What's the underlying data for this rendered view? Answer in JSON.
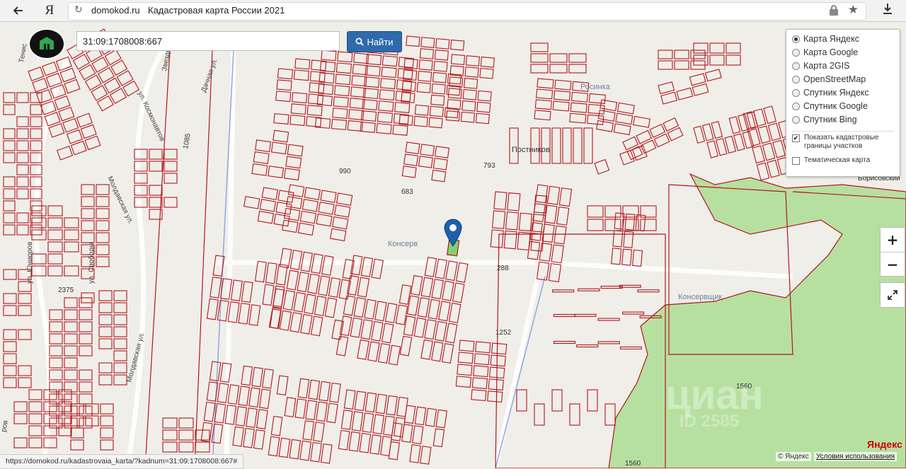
{
  "browser": {
    "domain": "domokod.ru",
    "page_title": "Кадастровая карта России 2021",
    "yandex_button": "Я",
    "back_icon": "arrow-left-icon",
    "reload_icon": "reload-icon",
    "lock_icon": "lock-icon",
    "star_icon": "star-icon",
    "download_icon": "download-icon"
  },
  "search": {
    "value": "31:09:1708008:667",
    "button_label": "Найти",
    "button_icon": "search-icon"
  },
  "layers": {
    "options": [
      {
        "label": "Карта Яндекс",
        "selected": true
      },
      {
        "label": "Карта Google",
        "selected": false
      },
      {
        "label": "Карта 2GIS",
        "selected": false
      },
      {
        "label": "OpenStreetMap",
        "selected": false
      },
      {
        "label": "Спутник Яндекс",
        "selected": false
      },
      {
        "label": "Спутник Google",
        "selected": false
      },
      {
        "label": "Спутник Bing",
        "selected": false
      }
    ],
    "show_borders": {
      "label": "Показать кадастровые границы участков",
      "checked": true
    },
    "thematic": {
      "label": "Тематическая карта",
      "checked": false
    }
  },
  "zoom": {
    "plus": "+",
    "minus": "−"
  },
  "map_labels": {
    "rosinka": "Росинка",
    "postnikov": "Постников",
    "konserv": "Консерв",
    "konservshchik": "Консервщик",
    "borisovsky": "Борисовский",
    "street_kosmonavtov": "ул. Космонавтов",
    "street_dachnaya": "Дачная ул.",
    "street_moldavskaya": "Молдавская ул.",
    "street_moldavskaya2": "Молдавская ул.",
    "street_yunorov": "ул. Юниоров",
    "street_svobody": "ул. Свободы",
    "street_zvezdnaya": "Звездная",
    "street_tenis": "Тенис",
    "street_rov": "ров",
    "lot_2375": "2375",
    "lot_1560": "1560",
    "lot_1560b": "1560",
    "lot_1085": "1085",
    "lot_1252": "1252",
    "lot_990": "990",
    "lot_288": "288",
    "lot_793": "793",
    "lot_683": "683"
  },
  "status_url": "https://domokod.ru/kadastrovaia_karta/?kadnum=31:09:1708008:667#",
  "attribution": {
    "copyright": "© Яндекс",
    "terms": "Условия использования",
    "logo": "Яндекс"
  },
  "watermark": {
    "text": "циан",
    "id": "ID 2585"
  },
  "colors": {
    "parcel_border": "#b4161b",
    "forest": "#b6e0a0",
    "selected_parcel": "#7fd36b",
    "search_button": "#2e6aac",
    "pin": "#1e5fb0"
  }
}
